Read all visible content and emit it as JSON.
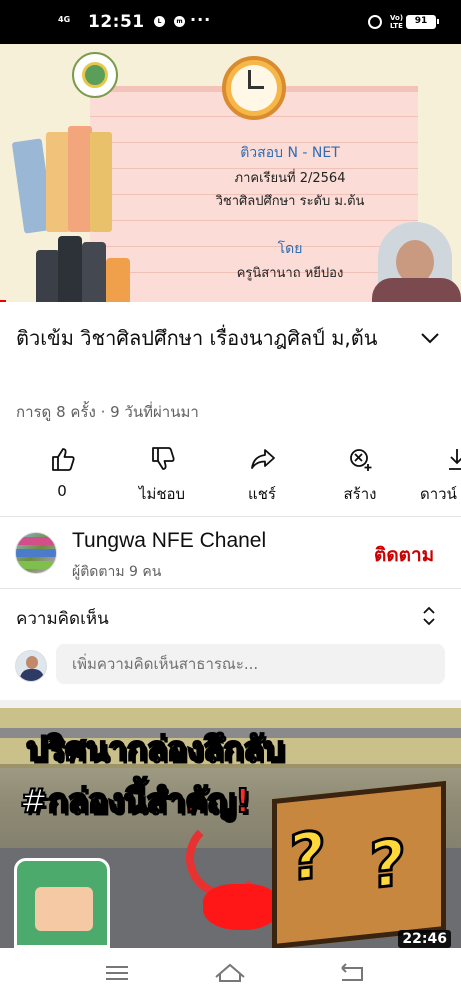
{
  "status_bar": {
    "network": "4G",
    "time": "12:51",
    "notification_icons": [
      "LINE",
      "messenger"
    ],
    "overflow": "···",
    "volte": "Vo) LTE",
    "battery": "91"
  },
  "video": {
    "slide_title": "ติวสอบ N - NET",
    "slide_term": "ภาคเรียนที่ 2/2564",
    "slide_subject": "วิชาศิลปศึกษา ระดับ ม.ต้น",
    "slide_by": "โดย",
    "slide_teacher": "ครูนิสานาถ  หยีปอง"
  },
  "title": "ติวเข้ม วิชาศิลปศึกษา เรื่องนาฎศิลป์ ม,ต้น",
  "meta": "การดู 8 ครั้ง · 9 วันที่ผ่านมา",
  "actions": {
    "like": "0",
    "dislike": "ไม่ชอบ",
    "share": "แชร์",
    "create": "สร้าง",
    "download": "ดาวน์"
  },
  "channel": {
    "name": "Tungwa NFE Chanel",
    "subscribers": "ผู้ติดตาม 9 คน",
    "subscribe_label": "ติดตาม"
  },
  "comments": {
    "title": "ความคิดเห็น",
    "placeholder": "เพิ่มความคิดเห็นสาธารณะ..."
  },
  "next_video": {
    "line1_white": "ปริศนา",
    "line1_yellow": "กล่องลึกลับ",
    "line2_white": "#กล่องนี้",
    "line2_red": "สำคัญ!",
    "duration": "22:46"
  },
  "colors": {
    "subscribe_red": "#cc0000",
    "slide_blue": "#2f6db3",
    "title_yellow": "#ffd93b",
    "title_red": "#ff2b2b"
  },
  "icons": [
    "like-icon",
    "dislike-icon",
    "share-icon",
    "create-icon",
    "download-icon",
    "chevron-down-icon",
    "sort-icon",
    "menu-icon",
    "home-icon",
    "back-icon"
  ]
}
